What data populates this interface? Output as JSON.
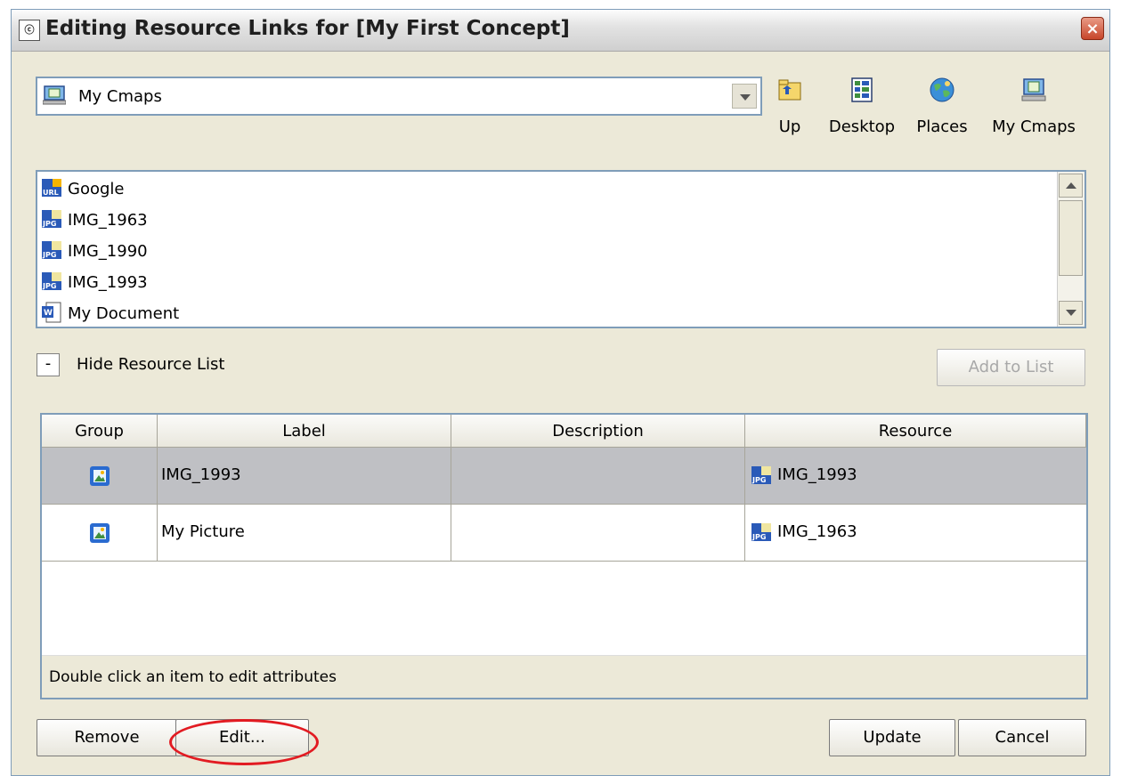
{
  "window": {
    "title": "Editing Resource Links for [My First  Concept]",
    "close_symbol": "×"
  },
  "location": {
    "selected": "My Cmaps"
  },
  "toolbar": {
    "up_label": "Up",
    "desktop_label": "Desktop",
    "places_label": "Places",
    "mycmaps_label": "My Cmaps"
  },
  "resource_list": {
    "items": [
      {
        "label": "Google",
        "icon": "url-icon"
      },
      {
        "label": "IMG_1963",
        "icon": "jpg-icon"
      },
      {
        "label": "IMG_1990",
        "icon": "jpg-icon"
      },
      {
        "label": "IMG_1993",
        "icon": "jpg-icon"
      },
      {
        "label": "My Document",
        "icon": "word-doc-icon"
      }
    ]
  },
  "resource_toggle": {
    "symbol": "-",
    "label": "Hide Resource List"
  },
  "add_to_list_label": "Add to List",
  "links_table": {
    "columns": [
      "Group",
      "Label",
      "Description",
      "Resource"
    ],
    "rows": [
      {
        "group_icon": "picture-icon",
        "label": "IMG_1993",
        "description": "",
        "resource": "IMG_1993",
        "resource_icon": "jpg-icon",
        "selected": true
      },
      {
        "group_icon": "picture-icon",
        "label": "My Picture",
        "description": "",
        "resource": "IMG_1963",
        "resource_icon": "jpg-icon",
        "selected": false
      }
    ],
    "status": "Double click an item to edit attributes"
  },
  "buttons": {
    "remove": "Remove",
    "edit": "Edit...",
    "update": "Update",
    "cancel": "Cancel"
  },
  "colors": {
    "selected_row": "#bfc0c4",
    "highlight": "#e21b22",
    "dialog_bg": "#ece9d8"
  }
}
